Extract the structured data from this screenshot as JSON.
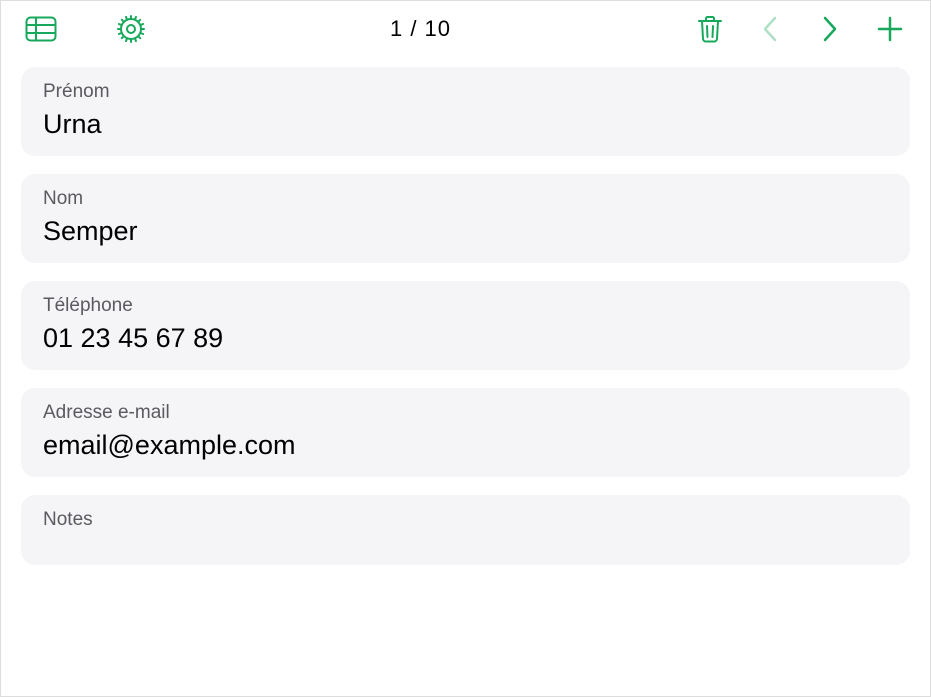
{
  "toolbar": {
    "page_indicator": "1 / 10",
    "prev_disabled": true,
    "next_disabled": false
  },
  "fields": {
    "prenom": {
      "label": "Prénom",
      "value": "Urna"
    },
    "nom": {
      "label": "Nom",
      "value": "Semper"
    },
    "telephone": {
      "label": "Téléphone",
      "value": "01 23 45 67 89"
    },
    "email": {
      "label": "Adresse e-mail",
      "value": "email@example.com"
    },
    "notes": {
      "label": "Notes",
      "value": ""
    }
  },
  "colors": {
    "accent": "#18a85b",
    "card_bg": "#f5f4f7",
    "label": "#5b5a5f"
  }
}
